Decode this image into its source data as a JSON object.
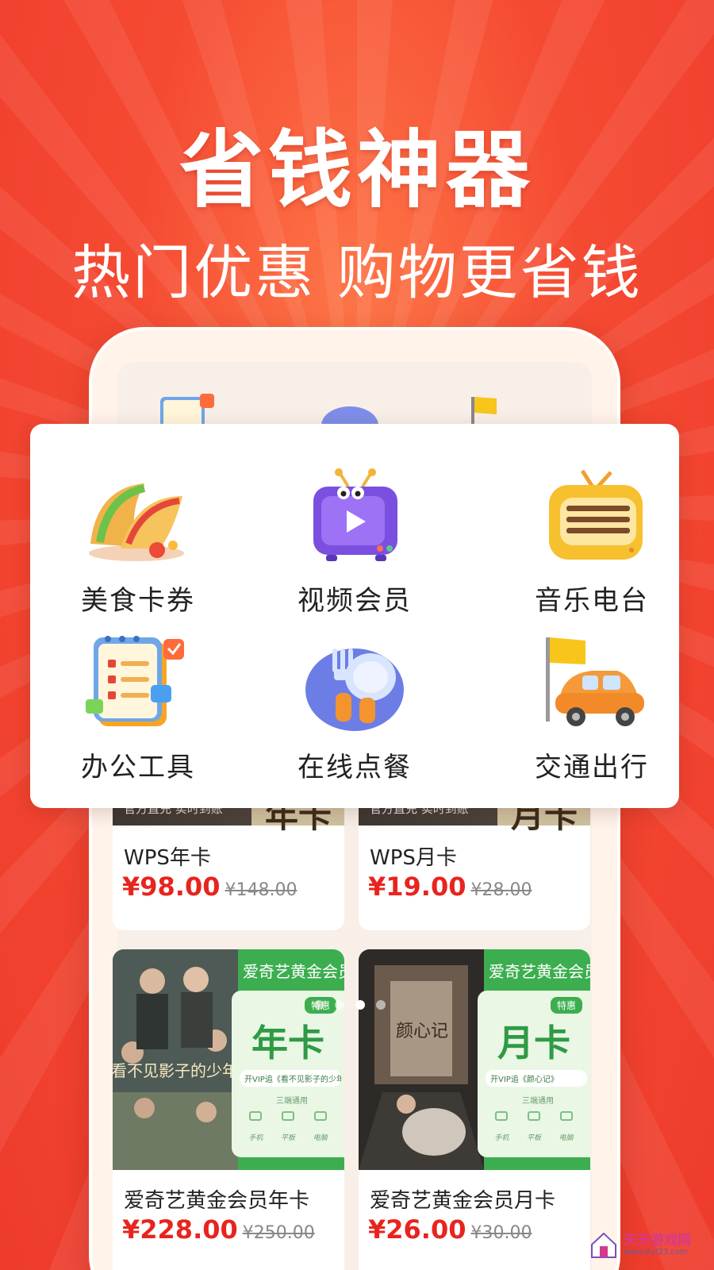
{
  "hero": {
    "title": "省钱神器",
    "subtitle": "热门优惠 购物更省钱"
  },
  "categories": [
    {
      "label": "美食卡券",
      "icon": "taco-icon"
    },
    {
      "label": "视频会员",
      "icon": "tv-icon"
    },
    {
      "label": "音乐电台",
      "icon": "radio-icon"
    },
    {
      "label": "办公工具",
      "icon": "notepad-icon"
    },
    {
      "label": "在线点餐",
      "icon": "fork-plate-icon"
    },
    {
      "label": "交通出行",
      "icon": "car-flag-icon"
    }
  ],
  "products": [
    {
      "name": "WPS年卡",
      "price": "¥98.00",
      "original": "¥148.00",
      "banner_tag": "官方直充  实时到账",
      "banner_big": "年卡"
    },
    {
      "name": "WPS月卡",
      "price": "¥19.00",
      "original": "¥28.00",
      "banner_tag": "官方直充  实时到账",
      "banner_big": "月卡"
    },
    {
      "name": "爱奇艺黄金会员年卡",
      "price": "¥228.00",
      "original": "¥250.00",
      "banner_title": "爱奇艺黄金会员",
      "banner_badge": "特惠",
      "banner_big": "年卡",
      "banner_line": "开VIP追《看不见影子的少年》",
      "banner_devices": "三端通用",
      "device_names": [
        "手机",
        "平板",
        "电脑"
      ]
    },
    {
      "name": "爱奇艺黄金会员月卡",
      "price": "¥26.00",
      "original": "¥30.00",
      "banner_title": "爱奇艺黄金会员",
      "banner_badge": "特惠",
      "banner_big": "月卡",
      "banner_line": "开VIP追《颜心记》",
      "banner_devices": "三端通用",
      "device_names": [
        "手机",
        "平板",
        "电脑"
      ]
    }
  ],
  "poster_text": [
    "看不见影子的少年",
    "颜心记"
  ],
  "watermark": {
    "main": "天天游戏网",
    "url": "www.ttyl23.com"
  },
  "colors": {
    "brand_red": "#f54a32",
    "price_red": "#e8241e",
    "iqiyi_green": "#3cae4f"
  }
}
